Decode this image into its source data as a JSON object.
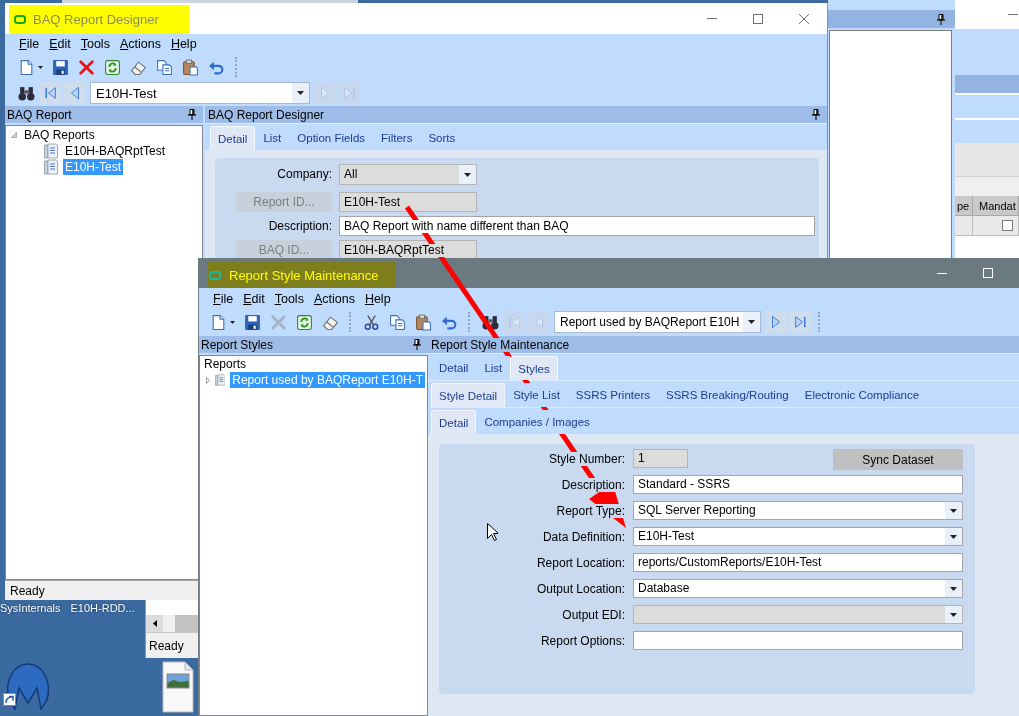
{
  "desktop": {
    "labels": [
      "SysInternals",
      "E10H-RDD..."
    ]
  },
  "background_window": {
    "grid": {
      "columns": [
        "pe",
        "Mandat"
      ],
      "rows": [
        {
          "checked": false
        }
      ]
    }
  },
  "small_window": {
    "status_bar": "Ready"
  },
  "baq_window": {
    "title": "BAQ Report Designer",
    "active": false,
    "highlighted": true,
    "menu": [
      "File",
      "Edit",
      "Tools",
      "Actions",
      "Help"
    ],
    "toolbars": [
      [
        {
          "kind": "new",
          "disabled": false
        },
        {
          "kind": "save",
          "disabled": false
        },
        {
          "kind": "delete",
          "disabled": false
        },
        {
          "kind": "refresh",
          "disabled": false
        },
        {
          "kind": "clear",
          "disabled": false
        },
        {
          "kind": "copy",
          "disabled": false
        },
        {
          "kind": "paste",
          "disabled": false
        },
        {
          "kind": "undo",
          "disabled": false
        },
        {
          "kind": "separator"
        }
      ],
      [
        {
          "kind": "search",
          "disabled": false
        },
        {
          "kind": "first",
          "disabled": false
        },
        {
          "kind": "previous",
          "disabled": false
        },
        {
          "kind": "record",
          "value": "E10H-Test"
        },
        {
          "kind": "next",
          "disabled": true
        },
        {
          "kind": "last",
          "disabled": true
        }
      ]
    ],
    "left_panel": {
      "title": "BAQ Report",
      "tree": [
        {
          "label": "BAQ Reports",
          "selected": false,
          "expanded": true,
          "children": [
            {
              "label": "E10H-BAQRptTest",
              "selected": false
            },
            {
              "label": "E10H-Test",
              "selected": true
            }
          ]
        }
      ]
    },
    "status_bar": "Ready",
    "main_panel": {
      "title": "BAQ Report Designer",
      "tab_rows": [
        [
          {
            "label": "Detail",
            "selected": true
          },
          {
            "label": "List",
            "selected": false
          },
          {
            "label": "Option Fields",
            "selected": false
          },
          {
            "label": "Filters",
            "selected": false
          },
          {
            "label": "Sorts",
            "selected": false
          }
        ]
      ],
      "form": {
        "fields": [
          {
            "kind": "combo",
            "label": "Company:",
            "value": "All",
            "readonly": true
          },
          {
            "kind": "lookup",
            "label": "Report ID...",
            "value": "E10H-Test",
            "readonly": true
          },
          {
            "kind": "text",
            "label": "Description:",
            "value": "BAQ Report with name different than BAQ",
            "readonly": false
          },
          {
            "kind": "lookup",
            "label": "BAQ ID...",
            "value": "E10H-BAQRptTest",
            "readonly": true
          }
        ]
      }
    }
  },
  "style_window": {
    "title": "Report Style Maintenance",
    "active": true,
    "highlighted": true,
    "menu": [
      "File",
      "Edit",
      "Tools",
      "Actions",
      "Help"
    ],
    "toolbars": [
      [
        {
          "kind": "new",
          "disabled": false
        },
        {
          "kind": "save",
          "disabled": false
        },
        {
          "kind": "delete",
          "disabled": true
        },
        {
          "kind": "refresh",
          "disabled": false
        },
        {
          "kind": "clear",
          "disabled": false
        },
        {
          "kind": "separator"
        },
        {
          "kind": "cut",
          "disabled": false
        },
        {
          "kind": "copy",
          "disabled": false
        },
        {
          "kind": "paste",
          "disabled": false
        },
        {
          "kind": "undo",
          "disabled": false
        },
        {
          "kind": "separator"
        },
        {
          "kind": "search",
          "disabled": false
        },
        {
          "kind": "first",
          "disabled": true
        },
        {
          "kind": "previous",
          "disabled": true
        },
        {
          "kind": "record",
          "value": "Report used by BAQReport E10H"
        },
        {
          "kind": "next",
          "disabled": false
        },
        {
          "kind": "last",
          "disabled": false
        },
        {
          "kind": "separator"
        }
      ]
    ],
    "left_panel": {
      "title": "Report Styles",
      "tree": [
        {
          "label": "Reports",
          "selected": false,
          "children": [
            {
              "label": "Report used by BAQReport E10H-T",
              "selected": true,
              "expanded": false
            }
          ]
        }
      ]
    },
    "main_panel": {
      "title": "Report Style Maintenance",
      "tab_rows": [
        [
          {
            "label": "Detail",
            "selected": false
          },
          {
            "label": "List",
            "selected": false
          },
          {
            "label": "Styles",
            "selected": true
          }
        ],
        [
          {
            "label": "Style Detail",
            "selected": true
          },
          {
            "label": "Style List",
            "selected": false
          },
          {
            "label": "SSRS Printers",
            "selected": false
          },
          {
            "label": "SSRS Breaking/Routing",
            "selected": false
          },
          {
            "label": "Electronic Compliance",
            "selected": false
          }
        ],
        [
          {
            "label": "Detail",
            "selected": true
          },
          {
            "label": "Companies / Images",
            "selected": false
          }
        ]
      ],
      "form": {
        "button": "Sync Dataset",
        "fields": [
          {
            "kind": "number",
            "label": "Style Number:",
            "value": "1",
            "readonly": true
          },
          {
            "kind": "text",
            "label": "Description:",
            "value": "Standard - SSRS",
            "readonly": false
          },
          {
            "kind": "combo",
            "label": "Report Type:",
            "value": "SQL Server Reporting",
            "readonly": false
          },
          {
            "kind": "combo",
            "label": "Data Definition:",
            "value": "E10H-Test",
            "readonly": false
          },
          {
            "kind": "text",
            "label": "Report Location:",
            "value": "reports/CustomReports/E10H-Test",
            "readonly": false
          },
          {
            "kind": "combo",
            "label": "Output Location:",
            "value": "Database",
            "readonly": false
          },
          {
            "kind": "combo",
            "label": "Output EDI:",
            "readonly": true
          },
          {
            "kind": "text",
            "label": "Report Options:",
            "readonly": false
          }
        ]
      }
    }
  },
  "annotations": [
    {
      "kind": "arrow"
    }
  ]
}
